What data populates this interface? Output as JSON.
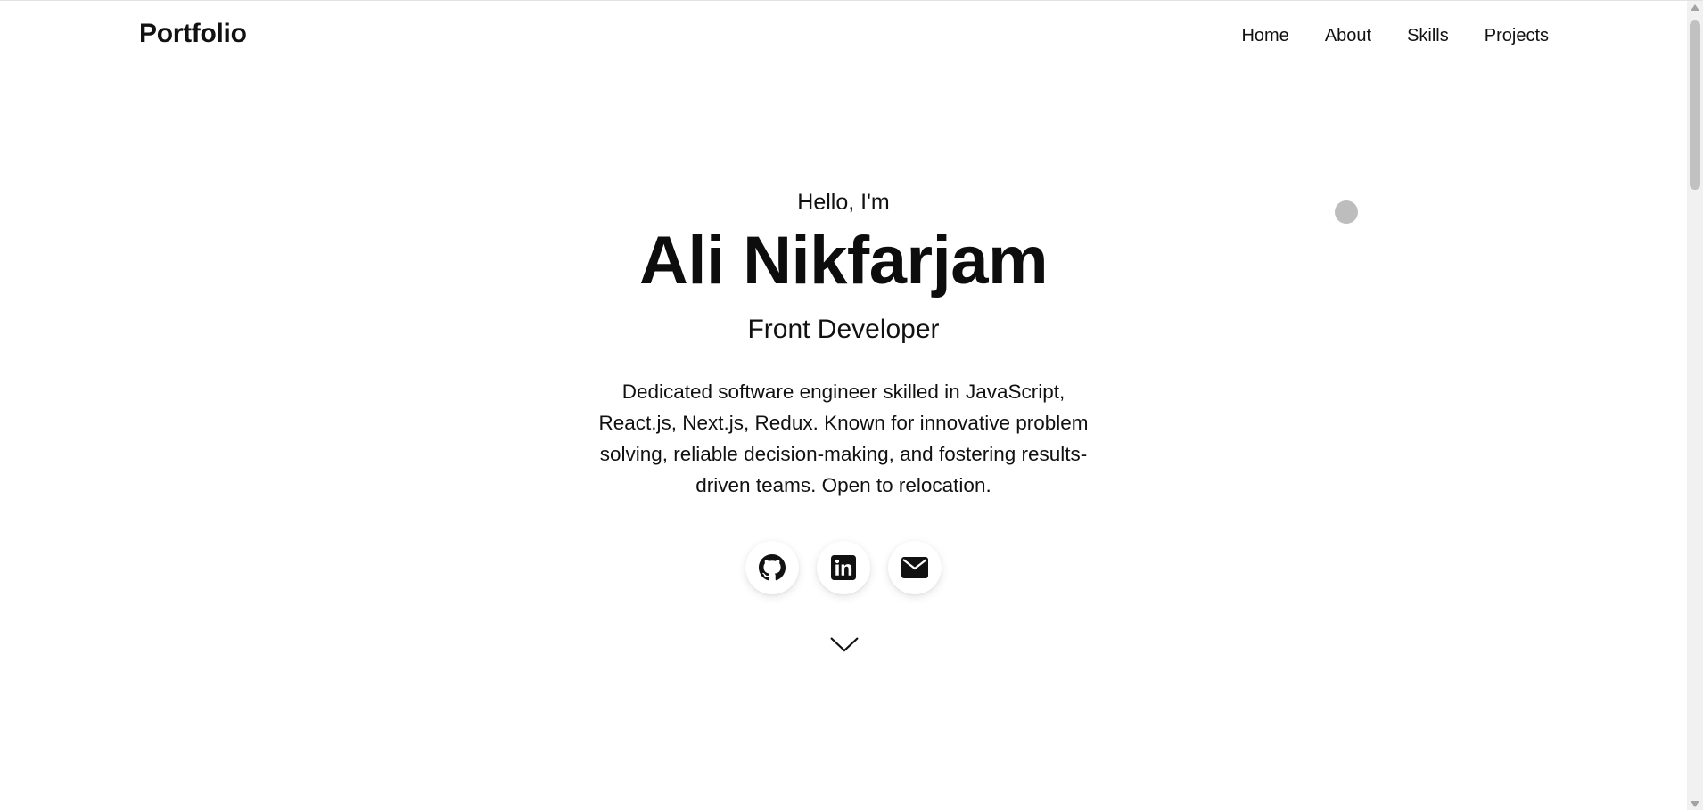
{
  "header": {
    "brand": "Portfolio",
    "nav": [
      {
        "label": "Home"
      },
      {
        "label": "About"
      },
      {
        "label": "Skills"
      },
      {
        "label": "Projects"
      }
    ]
  },
  "hero": {
    "greeting": "Hello, I'm",
    "name": "Ali Nikfarjam",
    "role": "Front Developer",
    "bio": "Dedicated software engineer skilled in JavaScript, React.js, Next.js, Redux. Known for innovative problem solving, reliable decision-making, and fostering results-driven teams. Open to relocation.",
    "socials": [
      {
        "icon": "github-icon"
      },
      {
        "icon": "linkedin-icon"
      },
      {
        "icon": "email-icon"
      }
    ],
    "scroll_icon": "chevron-down-icon"
  },
  "colors": {
    "text": "#111111",
    "background": "#ffffff",
    "cursor_dot": "#bdbdbd"
  }
}
